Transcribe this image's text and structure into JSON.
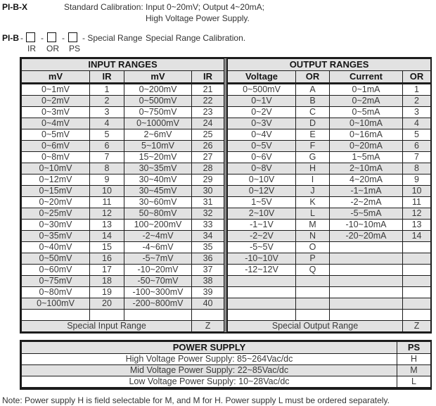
{
  "header": {
    "model_standard": "PI-B-X",
    "standard_label": "Standard Calibration:",
    "standard_desc_line1": "Input 0~20mV; Output 4~20mA;",
    "standard_desc_line2": "High Voltage Power Supply.",
    "model_special_prefix": "PI-B",
    "separator": "-",
    "special_suffix": "- Special Range",
    "box_labels": [
      "IR",
      "OR",
      "PS"
    ],
    "special_desc": "Special Range Calibration."
  },
  "input_ranges": {
    "title": "INPUT RANGES",
    "columns": [
      "mV",
      "IR",
      "mV",
      "IR"
    ],
    "rows": [
      [
        "0~1mV",
        "1",
        "0~200mV",
        "21"
      ],
      [
        "0~2mV",
        "2",
        "0~500mV",
        "22"
      ],
      [
        "0~3mV",
        "3",
        "0~750mV",
        "23"
      ],
      [
        "0~4mV",
        "4",
        "0~1000mV",
        "24"
      ],
      [
        "0~5mV",
        "5",
        "2~6mV",
        "25"
      ],
      [
        "0~6mV",
        "6",
        "5~10mV",
        "26"
      ],
      [
        "0~8mV",
        "7",
        "15~20mV",
        "27"
      ],
      [
        "0~10mV",
        "8",
        "30~35mV",
        "28"
      ],
      [
        "0~12mV",
        "9",
        "30~40mV",
        "29"
      ],
      [
        "0~15mV",
        "10",
        "30~45mV",
        "30"
      ],
      [
        "0~20mV",
        "11",
        "30~60mV",
        "31"
      ],
      [
        "0~25mV",
        "12",
        "50~80mV",
        "32"
      ],
      [
        "0~30mV",
        "13",
        "100~200mV",
        "33"
      ],
      [
        "0~35mV",
        "14",
        "-2~4mV",
        "34"
      ],
      [
        "0~40mV",
        "15",
        "-4~6mV",
        "35"
      ],
      [
        "0~50mV",
        "16",
        "-5~7mV",
        "36"
      ],
      [
        "0~60mV",
        "17",
        "-10~20mV",
        "37"
      ],
      [
        "0~75mV",
        "18",
        "-50~70mV",
        "38"
      ],
      [
        "0~80mV",
        "19",
        "-100~300mV",
        "39"
      ],
      [
        "0~100mV",
        "20",
        "-200~800mV",
        "40"
      ],
      [
        "",
        "",
        "",
        ""
      ]
    ],
    "special": {
      "label": "Special Input Range",
      "code": "Z"
    }
  },
  "output_ranges": {
    "title": "OUTPUT RANGES",
    "columns": [
      "Voltage",
      "OR",
      "Current",
      "OR"
    ],
    "rows": [
      [
        "0~500mV",
        "A",
        "0~1mA",
        "1"
      ],
      [
        "0~1V",
        "B",
        "0~2mA",
        "2"
      ],
      [
        "0~2V",
        "C",
        "0~5mA",
        "3"
      ],
      [
        "0~3V",
        "D",
        "0~10mA",
        "4"
      ],
      [
        "0~4V",
        "E",
        "0~16mA",
        "5"
      ],
      [
        "0~5V",
        "F",
        "0~20mA",
        "6"
      ],
      [
        "0~6V",
        "G",
        "1~5mA",
        "7"
      ],
      [
        "0~8V",
        "H",
        "2~10mA",
        "8"
      ],
      [
        "0~10V",
        "I",
        "4~20mA",
        "9"
      ],
      [
        "0~12V",
        "J",
        "-1~1mA",
        "10"
      ],
      [
        "1~5V",
        "K",
        "-2~2mA",
        "11"
      ],
      [
        "2~10V",
        "L",
        "-5~5mA",
        "12"
      ],
      [
        "-1~1V",
        "M",
        "-10~10mA",
        "13"
      ],
      [
        "-2~2V",
        "N",
        "-20~20mA",
        "14"
      ],
      [
        "-5~5V",
        "O",
        "",
        ""
      ],
      [
        "-10~10V",
        "P",
        "",
        ""
      ],
      [
        "-12~12V",
        "Q",
        "",
        ""
      ],
      [
        "",
        "",
        "",
        ""
      ],
      [
        "",
        "",
        "",
        ""
      ],
      [
        "",
        "",
        "",
        ""
      ],
      [
        "",
        "",
        "",
        ""
      ]
    ],
    "special": {
      "label": "Special Output Range",
      "code": "Z"
    }
  },
  "power_supply": {
    "title": "POWER SUPPLY",
    "code_header": "PS",
    "rows": [
      {
        "label": "High Voltage Power Supply: 85~264Vac/dc",
        "code": "H"
      },
      {
        "label": "Mid Voltage Power Supply: 22~85Vac/dc",
        "code": "M"
      },
      {
        "label": "Low Voltage Power Supply: 10~28Vac/dc",
        "code": "L"
      }
    ]
  },
  "note": "Note:  Power supply H is field selectable for M, and M for H. Power supply L must be ordered separately."
}
